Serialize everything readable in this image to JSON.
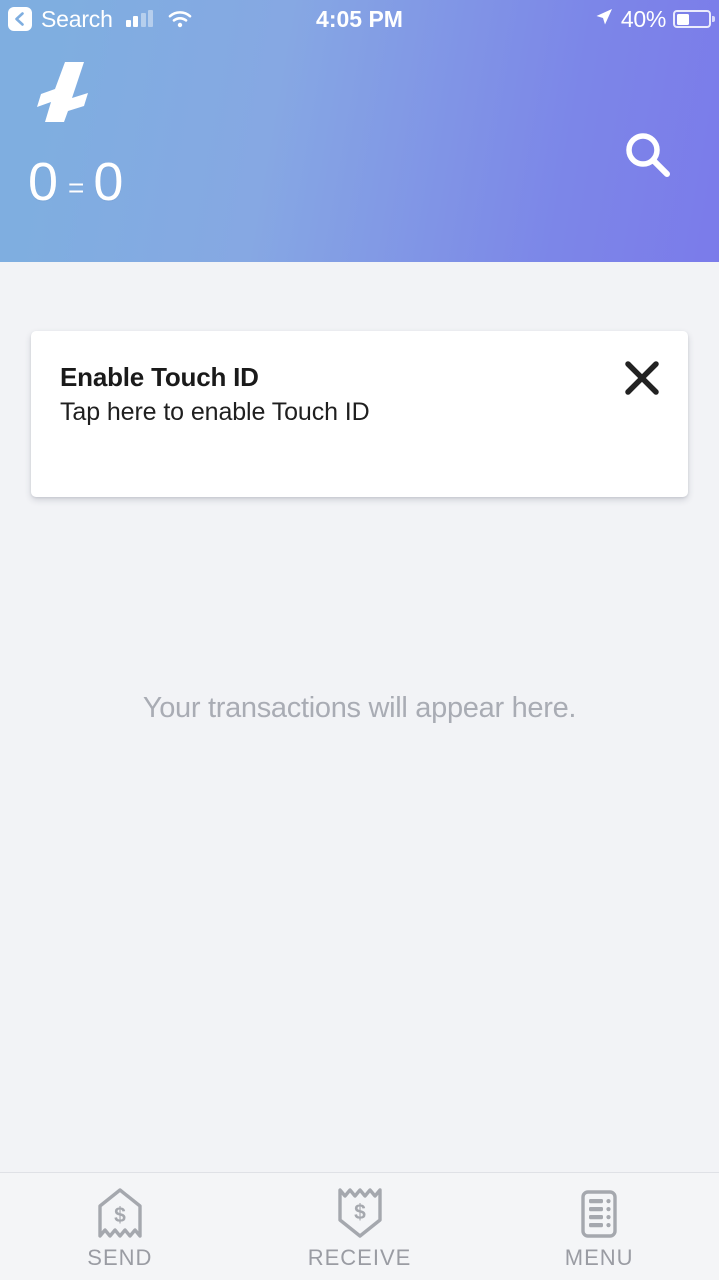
{
  "statusbar": {
    "back_label": "Search",
    "time": "4:05 PM",
    "battery_percent": "40%",
    "signal_icon": "cellular-signal-icon",
    "wifi_icon": "wifi-icon",
    "location_icon": "location-arrow-icon",
    "battery_icon": "battery-icon",
    "back_icon": "back-chevron-icon"
  },
  "header": {
    "logo_icon": "litecoin-logo",
    "balance_amount": "0",
    "balance_separator": "=",
    "balance_fiat": "0",
    "search_icon": "search-icon",
    "gradient_start": "#7FAEE0",
    "gradient_end": "#7B7BEA"
  },
  "card": {
    "title": "Enable Touch ID",
    "subtitle": "Tap here to enable Touch ID",
    "close_icon": "close-icon"
  },
  "main": {
    "empty_state": "Your transactions will appear here."
  },
  "tabbar": {
    "items": [
      {
        "label": "SEND",
        "icon": "send-receipt-icon"
      },
      {
        "label": "RECEIVE",
        "icon": "receive-receipt-icon"
      },
      {
        "label": "MENU",
        "icon": "menu-list-icon"
      }
    ]
  }
}
